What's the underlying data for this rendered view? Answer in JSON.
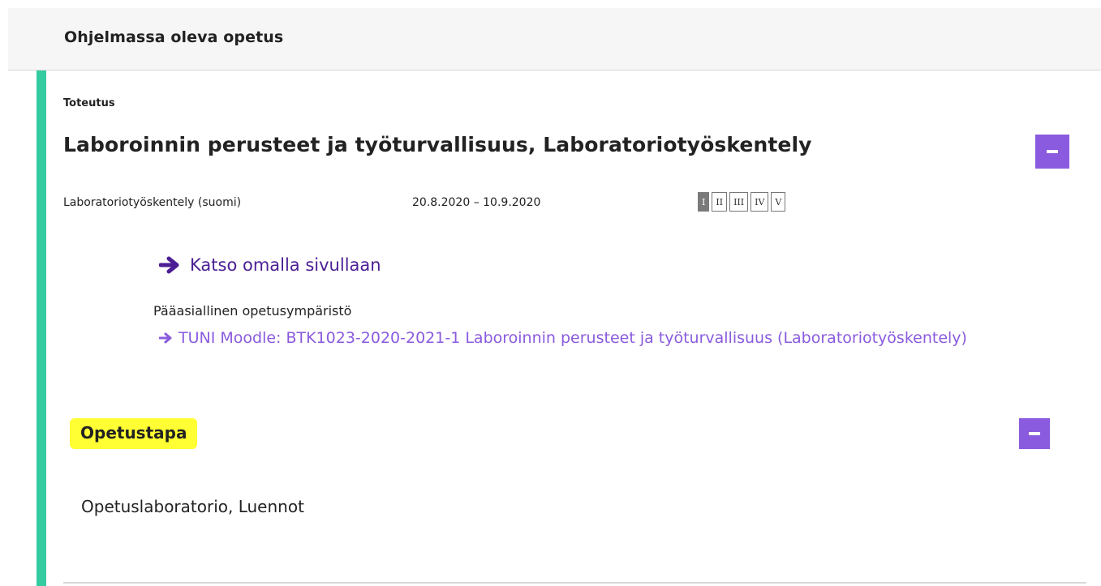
{
  "section": {
    "title": "Ohjelmassa oleva opetus"
  },
  "implementation": {
    "type_label": "Toteutus",
    "title": "Laboroinnin perusteet ja työturvallisuus, Laboratoriotyöskentely",
    "collapse_icon": "minus-icon",
    "language": "Laboratoriotyöskentely (suomi)",
    "dates": "20.8.2020 – 10.9.2020",
    "periods": [
      {
        "label": "I",
        "active": true
      },
      {
        "label": "II",
        "active": false
      },
      {
        "label": "III",
        "active": false
      },
      {
        "label": "IV",
        "active": false
      },
      {
        "label": "V",
        "active": false
      }
    ],
    "own_page_link": "Katso omalla sivullaan",
    "learning_env_label": "Pääasiallinen opetusympäristö",
    "learning_env_link": "TUNI Moodle: BTK1023-2020-2021-1 Laboroinnin perusteet ja työturvallisuus (Laboratoriotyöskentely)"
  },
  "teaching_method": {
    "heading": "Opetustapa",
    "value": "Opetuslaboratorio, Luennot",
    "collapse_icon": "minus-icon"
  },
  "colors": {
    "accent_bar": "#35cba0",
    "button": "#8a5bde",
    "primary_link": "#4b1e94",
    "secondary_link": "#8a5bde",
    "highlight": "#ffff33",
    "active_period": "#7a7a7a"
  }
}
